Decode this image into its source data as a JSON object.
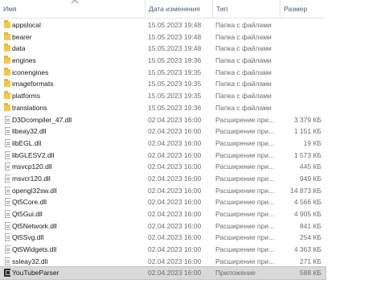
{
  "columns": {
    "name": "Имя",
    "date": "Дата изменения",
    "type": "Тип",
    "size": "Размер"
  },
  "sort_icon": "chevron-up-icon",
  "files": [
    {
      "name": "appslocal",
      "date": "15.05.2023 19:48",
      "type": "Папка с файлами",
      "size": "",
      "icon": "folder-icon"
    },
    {
      "name": "bearer",
      "date": "15.05.2023 19:48",
      "type": "Папка с файлами",
      "size": "",
      "icon": "folder-icon"
    },
    {
      "name": "data",
      "date": "15.05.2023 19:48",
      "type": "Папка с файлами",
      "size": "",
      "icon": "folder-icon"
    },
    {
      "name": "engines",
      "date": "15.05.2023 19:36",
      "type": "Папка с файлами",
      "size": "",
      "icon": "folder-icon"
    },
    {
      "name": "iconengines",
      "date": "15.05.2023 19:35",
      "type": "Папка с файлами",
      "size": "",
      "icon": "folder-icon"
    },
    {
      "name": "imageformats",
      "date": "15.05.2023 19:35",
      "type": "Папка с файлами",
      "size": "",
      "icon": "folder-icon"
    },
    {
      "name": "platforms",
      "date": "15.05.2023 19:35",
      "type": "Папка с файлами",
      "size": "",
      "icon": "folder-icon"
    },
    {
      "name": "translations",
      "date": "15.05.2023 19:36",
      "type": "Папка с файлами",
      "size": "",
      "icon": "folder-icon"
    },
    {
      "name": "D3Dcompiler_47.dll",
      "date": "02.04.2023 16:00",
      "type": "Расширение при...",
      "size": "3 379 КБ",
      "icon": "file-icon"
    },
    {
      "name": "libeay32.dll",
      "date": "02.04.2023 16:00",
      "type": "Расширение при...",
      "size": "1 151 КБ",
      "icon": "file-icon"
    },
    {
      "name": "libEGL.dll",
      "date": "02.04.2023 16:00",
      "type": "Расширение при...",
      "size": "19 КБ",
      "icon": "file-icon"
    },
    {
      "name": "libGLESV2.dll",
      "date": "02.04.2023 16:00",
      "type": "Расширение при...",
      "size": "1 573 КБ",
      "icon": "file-icon"
    },
    {
      "name": "msvcp120.dll",
      "date": "02.04.2023 16:00",
      "type": "Расширение при...",
      "size": "445 КБ",
      "icon": "file-icon"
    },
    {
      "name": "msvcr120.dll",
      "date": "02.04.2023 16:00",
      "type": "Расширение при...",
      "size": "949 КБ",
      "icon": "file-icon"
    },
    {
      "name": "opengl32sw.dll",
      "date": "02.04.2023 16:00",
      "type": "Расширение при...",
      "size": "14 873 КБ",
      "icon": "file-icon"
    },
    {
      "name": "Qt5Core.dll",
      "date": "02.04.2023 16:00",
      "type": "Расширение при...",
      "size": "4 566 КБ",
      "icon": "file-icon"
    },
    {
      "name": "Qt5Gui.dll",
      "date": "02.04.2023 16:00",
      "type": "Расширение при...",
      "size": "4 905 КБ",
      "icon": "file-icon"
    },
    {
      "name": "Qt5Network.dll",
      "date": "02.04.2023 16:00",
      "type": "Расширение при...",
      "size": "841 КБ",
      "icon": "file-icon"
    },
    {
      "name": "Qt5Svg.dll",
      "date": "02.04.2023 16:00",
      "type": "Расширение при...",
      "size": "254 КБ",
      "icon": "file-icon"
    },
    {
      "name": "Qt5Widgets.dll",
      "date": "02.04.2023 16:00",
      "type": "Расширение при...",
      "size": "4 363 КБ",
      "icon": "file-icon"
    },
    {
      "name": "ssleay32.dll",
      "date": "02.04.2023 16:00",
      "type": "Расширение при...",
      "size": "271 КБ",
      "icon": "file-icon"
    },
    {
      "name": "YouTubeParser",
      "date": "02.04.2023 16:00",
      "type": "Приложение",
      "size": "588 КБ",
      "icon": "app-icon",
      "selected": true
    }
  ]
}
